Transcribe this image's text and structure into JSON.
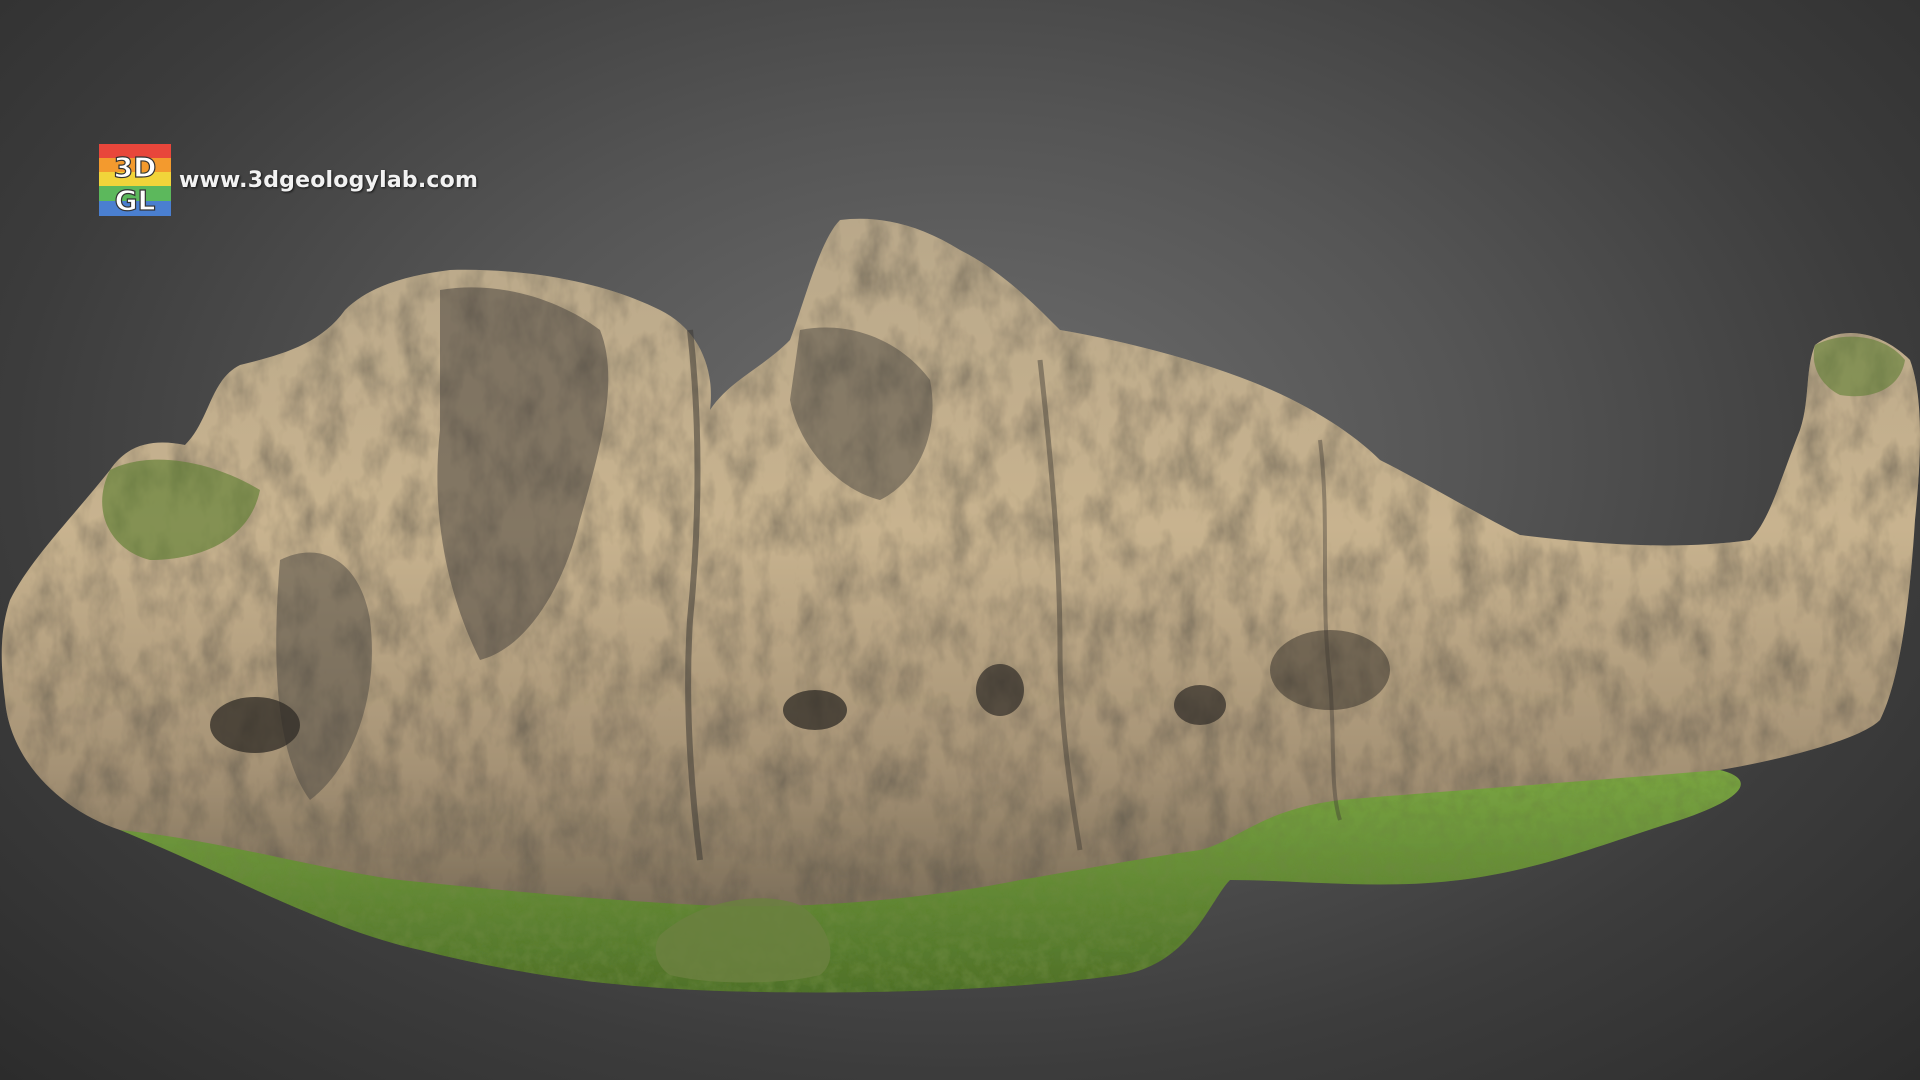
{
  "watermark": {
    "logo_text_top": "3D",
    "logo_text_bottom": "GL",
    "url": "www.3dgeologylab.com"
  },
  "scene": {
    "subject": "rock-outcrop-3d-model",
    "colors": {
      "background_center": "#6e6e6e",
      "background_edge": "#2c2c2c",
      "rock_light": "#c9b491",
      "rock_mid": "#9e8c70",
      "rock_dark": "#4e4a43",
      "grass": "#6f9a3a",
      "grass_dark": "#4d6e28"
    }
  }
}
